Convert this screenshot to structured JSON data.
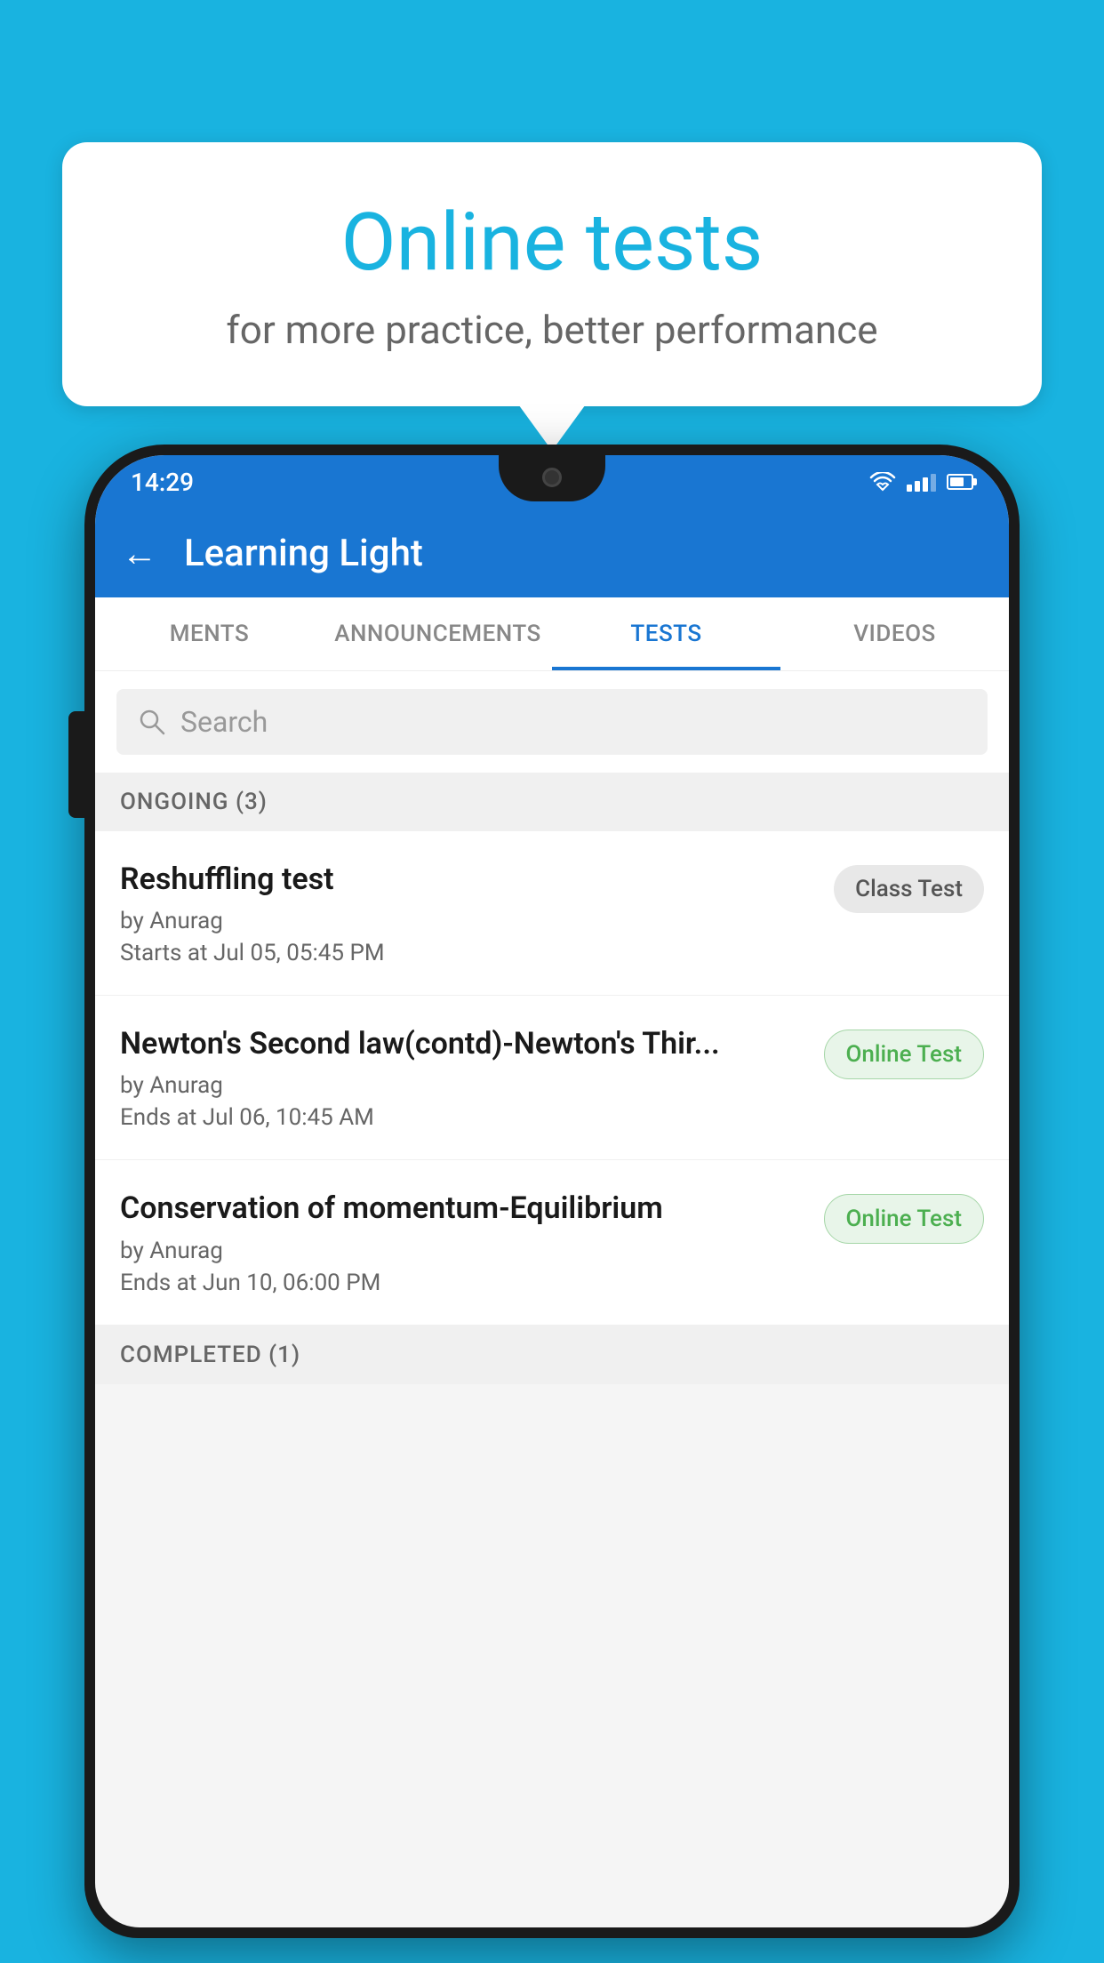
{
  "background_color": "#19b3e0",
  "speech_bubble": {
    "title": "Online tests",
    "subtitle": "for more practice, better performance"
  },
  "phone": {
    "status_bar": {
      "time": "14:29"
    },
    "app_header": {
      "title": "Learning Light"
    },
    "tabs": [
      {
        "label": "MENTS",
        "active": false
      },
      {
        "label": "ANNOUNCEMENTS",
        "active": false
      },
      {
        "label": "TESTS",
        "active": true
      },
      {
        "label": "VIDEOS",
        "active": false
      }
    ],
    "search": {
      "placeholder": "Search"
    },
    "ongoing_section": {
      "label": "ONGOING (3)"
    },
    "tests": [
      {
        "name": "Reshuffling test",
        "author": "by Anurag",
        "time": "Starts at  Jul 05, 05:45 PM",
        "badge": "Class Test",
        "badge_type": "class"
      },
      {
        "name": "Newton's Second law(contd)-Newton's Thir...",
        "author": "by Anurag",
        "time": "Ends at  Jul 06, 10:45 AM",
        "badge": "Online Test",
        "badge_type": "online"
      },
      {
        "name": "Conservation of momentum-Equilibrium",
        "author": "by Anurag",
        "time": "Ends at  Jun 10, 06:00 PM",
        "badge": "Online Test",
        "badge_type": "online"
      }
    ],
    "completed_section": {
      "label": "COMPLETED (1)"
    }
  }
}
